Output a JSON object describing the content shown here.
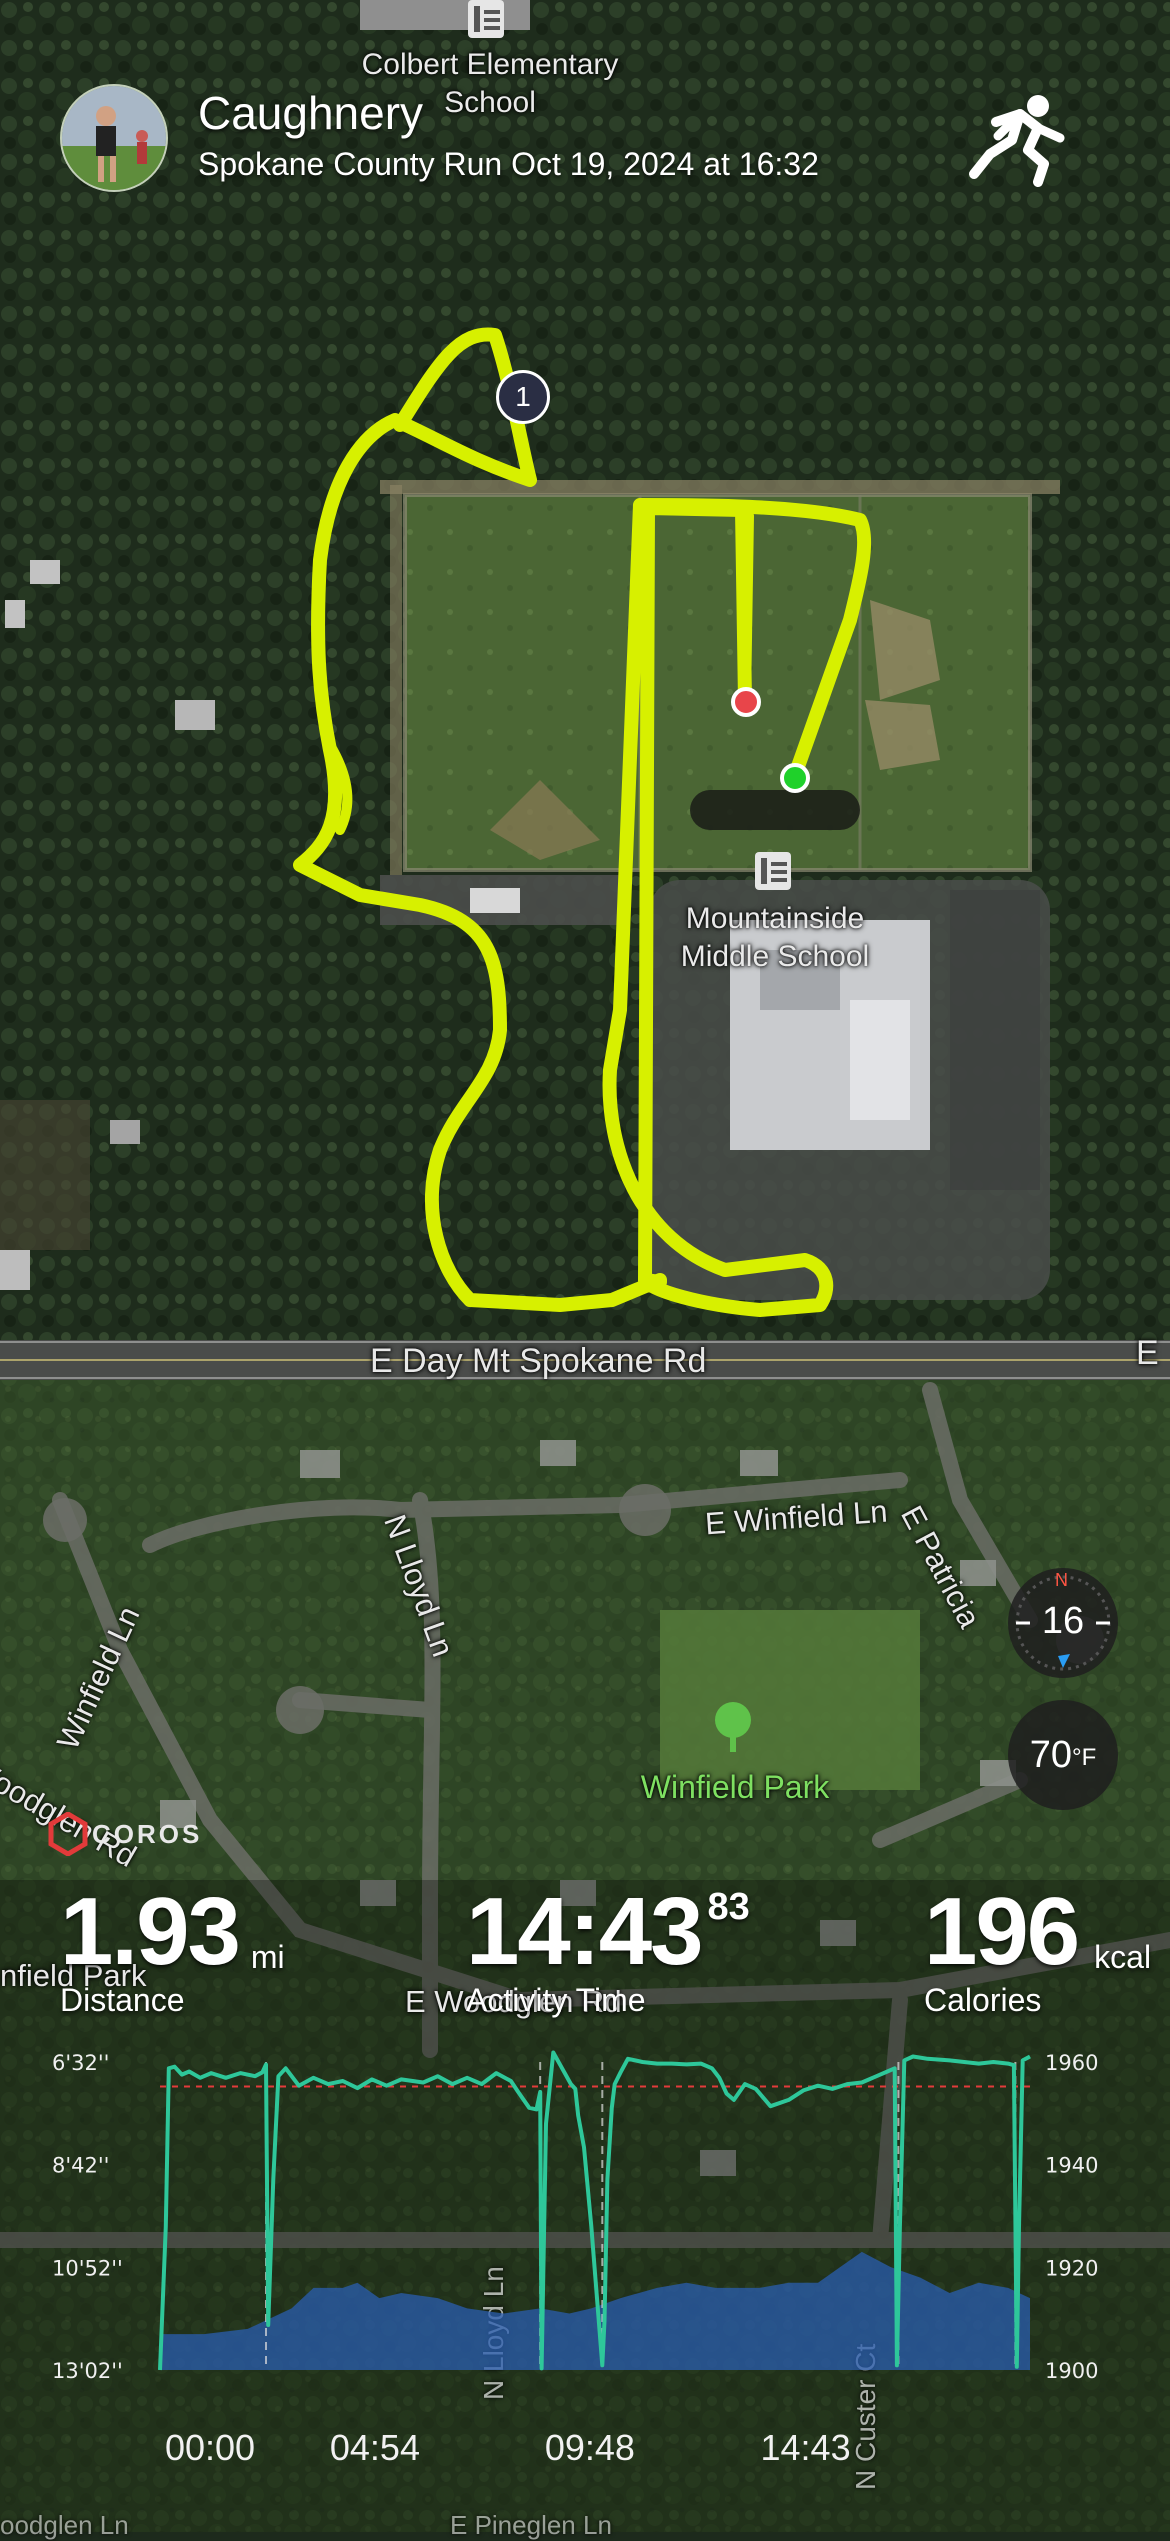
{
  "header": {
    "user_name": "Caughnery",
    "subtitle": "Spokane County Run Oct 19, 2024 at 16:32",
    "activity_icon": "running-person-icon"
  },
  "map": {
    "labels": {
      "school_top": "Colbert Elementary School",
      "school_mid_line1": "Mountainside",
      "school_mid_line2": "Middle School",
      "road_day": "E Day Mt Spokane Rd",
      "road_day_end": "E",
      "winfield_ln_e": "E Winfield Ln",
      "patricia": "E Patricia",
      "lloyd": "N Lloyd Ln",
      "winfield_ln": "Winfield Ln",
      "woodglen_left": "Woodglen Rd",
      "park": "Winfield Park",
      "winfield_park_left": "nfield Park",
      "woodglen_bottom": "E Woodglen Rd",
      "lloyd_bottom": "N Lloyd Ln",
      "custer": "N Custer Ct",
      "bottom_left": "oodglen Ln",
      "bottom_center": "E Pineglen Ln"
    },
    "lap_marker": "1",
    "route_color": "#d7f000",
    "start_color": "#1fd12a",
    "end_color": "#e8454a",
    "compass": {
      "value": "16",
      "north": "N"
    },
    "temperature": {
      "value": "70",
      "unit": "°F"
    },
    "brand": "COROS"
  },
  "stats": {
    "distance": {
      "value": "1.93",
      "unit": "mi",
      "label": "Distance"
    },
    "time": {
      "value": "14:43",
      "fraction": "83",
      "label": "Activity Time"
    },
    "calories": {
      "value": "196",
      "unit": "kcal",
      "label": "Calories"
    }
  },
  "chart_data": {
    "type": "line",
    "x_tick_labels": [
      "00:00",
      "04:54",
      "09:48",
      "14:43"
    ],
    "y_left_tick_labels": [
      "6'32''",
      "8'42''",
      "10'52''",
      "13'02''"
    ],
    "y_right_tick_labels": [
      "1960",
      "1940",
      "1920",
      "1900"
    ],
    "pace_axis_seconds": [
      392,
      782
    ],
    "elevation_axis": [
      1900,
      1960
    ],
    "average_pace_line_seconds": 423,
    "lap_markers_seconds": [
      145,
      520,
      605,
      1010,
      1170
    ],
    "pace_series": {
      "name": "Pace",
      "color": "#2ec79a",
      "points": [
        [
          0,
          782
        ],
        [
          8,
          600
        ],
        [
          12,
          400
        ],
        [
          20,
          398
        ],
        [
          30,
          408
        ],
        [
          40,
          404
        ],
        [
          55,
          412
        ],
        [
          70,
          406
        ],
        [
          90,
          412
        ],
        [
          110,
          406
        ],
        [
          130,
          410
        ],
        [
          140,
          405
        ],
        [
          145,
          395
        ],
        [
          148,
          725
        ],
        [
          155,
          540
        ],
        [
          162,
          410
        ],
        [
          172,
          400
        ],
        [
          190,
          422
        ],
        [
          210,
          412
        ],
        [
          230,
          420
        ],
        [
          250,
          416
        ],
        [
          270,
          425
        ],
        [
          290,
          414
        ],
        [
          310,
          422
        ],
        [
          330,
          414
        ],
        [
          360,
          418
        ],
        [
          380,
          410
        ],
        [
          400,
          420
        ],
        [
          420,
          412
        ],
        [
          440,
          420
        ],
        [
          460,
          406
        ],
        [
          480,
          416
        ],
        [
          490,
          430
        ],
        [
          505,
          450
        ],
        [
          515,
          452
        ],
        [
          520,
          430
        ],
        [
          522,
          780
        ],
        [
          528,
          470
        ],
        [
          538,
          380
        ],
        [
          550,
          400
        ],
        [
          562,
          420
        ],
        [
          568,
          426
        ],
        [
          572,
          460
        ],
        [
          580,
          500
        ],
        [
          590,
          600
        ],
        [
          605,
          776
        ],
        [
          608,
          720
        ],
        [
          612,
          540
        ],
        [
          618,
          450
        ],
        [
          622,
          420
        ],
        [
          630,
          405
        ],
        [
          640,
          388
        ],
        [
          660,
          392
        ],
        [
          680,
          394
        ],
        [
          700,
          394
        ],
        [
          720,
          395
        ],
        [
          740,
          394
        ],
        [
          755,
          400
        ],
        [
          765,
          412
        ],
        [
          775,
          432
        ],
        [
          785,
          440
        ],
        [
          800,
          420
        ],
        [
          815,
          426
        ],
        [
          835,
          448
        ],
        [
          860,
          440
        ],
        [
          880,
          428
        ],
        [
          900,
          422
        ],
        [
          920,
          426
        ],
        [
          940,
          420
        ],
        [
          960,
          418
        ],
        [
          980,
          410
        ],
        [
          995,
          404
        ],
        [
          1005,
          400
        ],
        [
          1008,
          776
        ],
        [
          1012,
          600
        ],
        [
          1018,
          390
        ],
        [
          1030,
          385
        ],
        [
          1050,
          388
        ],
        [
          1080,
          390
        ],
        [
          1100,
          392
        ],
        [
          1120,
          394
        ],
        [
          1140,
          392
        ],
        [
          1160,
          394
        ],
        [
          1168,
          396
        ],
        [
          1172,
          778
        ],
        [
          1175,
          600
        ],
        [
          1180,
          390
        ],
        [
          1190,
          385
        ]
      ]
    },
    "elevation_series": {
      "name": "Elevation",
      "color": "#2a5db0",
      "points": [
        [
          0,
          1907
        ],
        [
          60,
          1907
        ],
        [
          120,
          1908
        ],
        [
          180,
          1912
        ],
        [
          210,
          1916
        ],
        [
          250,
          1916
        ],
        [
          270,
          1917
        ],
        [
          300,
          1914
        ],
        [
          330,
          1915
        ],
        [
          380,
          1914
        ],
        [
          420,
          1912
        ],
        [
          470,
          1911
        ],
        [
          520,
          1912
        ],
        [
          560,
          1911
        ],
        [
          590,
          1912
        ],
        [
          630,
          1914
        ],
        [
          680,
          1916
        ],
        [
          720,
          1917
        ],
        [
          760,
          1916
        ],
        [
          820,
          1916
        ],
        [
          860,
          1917
        ],
        [
          900,
          1917
        ],
        [
          930,
          1920
        ],
        [
          960,
          1923
        ],
        [
          1000,
          1920
        ],
        [
          1040,
          1918
        ],
        [
          1080,
          1915
        ],
        [
          1120,
          1917
        ],
        [
          1160,
          1916
        ],
        [
          1190,
          1914
        ]
      ]
    }
  }
}
